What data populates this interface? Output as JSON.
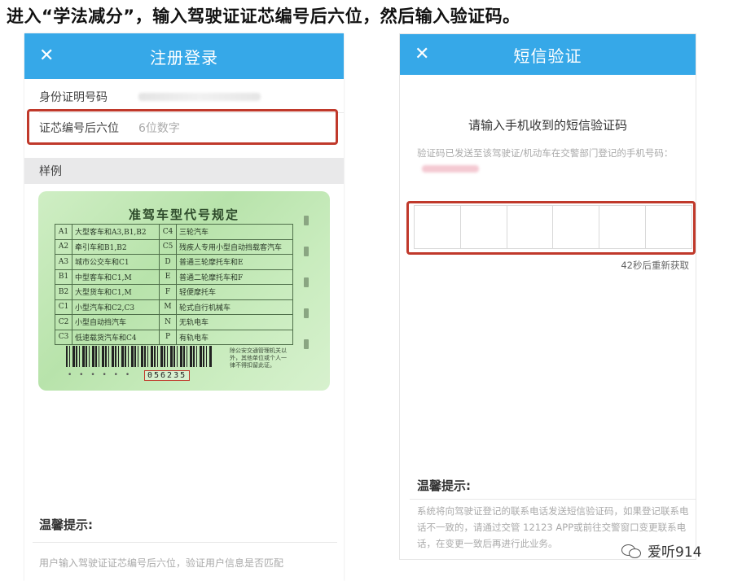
{
  "caption": "进入“学法减分”，输入驾驶证证芯编号后六位，然后输入验证码。",
  "left_screen": {
    "title": "注册登录",
    "close_glyph": "✕",
    "id_label": "身份证明号码",
    "chip_label": "证芯编号后六位",
    "chip_placeholder": "6位数字",
    "sample_label": "样例",
    "license_card": {
      "title": "准驾车型代号规定",
      "rows": [
        {
          "c1": "A1",
          "d1": "大型客车和A3,B1,B2",
          "c2": "C4",
          "d2": "三轮汽车"
        },
        {
          "c1": "A2",
          "d1": "牵引车和B1,B2",
          "c2": "C5",
          "d2": "残疾人专用小型自动挡载客汽车"
        },
        {
          "c1": "A3",
          "d1": "城市公交车和C1",
          "c2": "D",
          "d2": "普通三轮摩托车和E"
        },
        {
          "c1": "B1",
          "d1": "中型客车和C1,M",
          "c2": "E",
          "d2": "普通二轮摩托车和F"
        },
        {
          "c1": "B2",
          "d1": "大型货车和C1,M",
          "c2": "F",
          "d2": "轻便摩托车"
        },
        {
          "c1": "C1",
          "d1": "小型汽车和C2,C3",
          "c2": "M",
          "d2": "轮式自行机械车"
        },
        {
          "c1": "C2",
          "d1": "小型自动挡汽车",
          "c2": "N",
          "d2": "无轨电车"
        },
        {
          "c1": "C3",
          "d1": "低速载货汽车和C4",
          "c2": "P",
          "d2": "有轨电车"
        }
      ],
      "serial_number": "056235",
      "note": "除公安交通管理机关以外，其他单位或个人一律不得扣留此证。"
    },
    "tips_title": "温馨提示:",
    "tips_text": "用户输入驾驶证证芯编号后六位，验证用户信息是否匹配"
  },
  "right_screen": {
    "title": "短信验证",
    "close_glyph": "✕",
    "prompt": "请输入手机收到的短信验证码",
    "hint": "验证码已发送至该驾驶证/机动车在交警部门登记的手机号码：",
    "code_box_count": 6,
    "resend": "42秒后重新获取",
    "tips_title": "温馨提示:",
    "tips_text": "系统将向驾驶证登记的联系电话发送短信验证码，如果登记联系电话不一致的，请通过交管 12123 APP或前往交警窗口变更联系电话，在变更一致后再进行此业务。"
  },
  "watermark": "爱听914",
  "colors": {
    "app_bar": "#36a8e8",
    "highlight": "#c0392b"
  }
}
